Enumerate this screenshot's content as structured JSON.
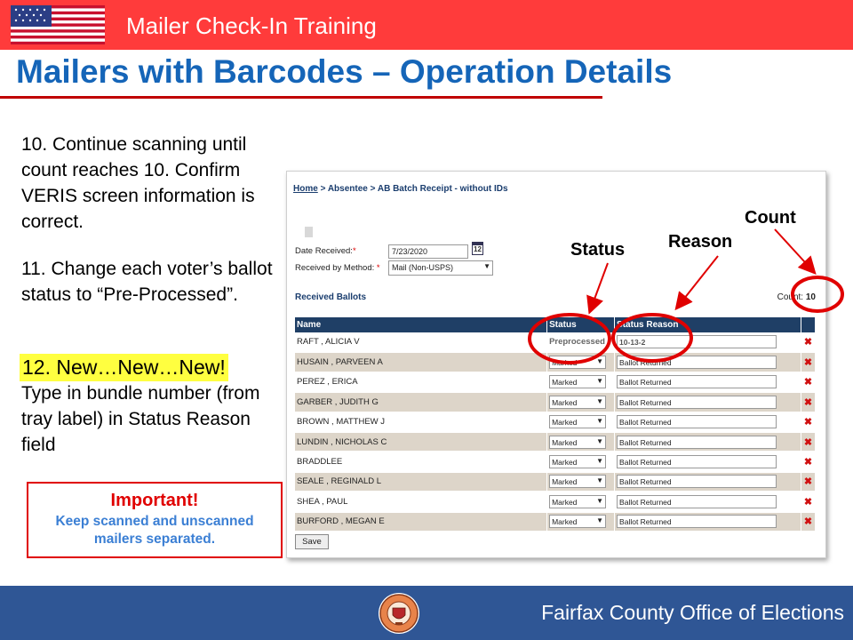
{
  "header": {
    "title": "Mailer Check-In Training",
    "main_title": "Mailers with Barcodes – Operation Details"
  },
  "steps": {
    "step10": "10.  Continue scanning until count reaches 10. Confirm VERIS screen information is correct.",
    "step11": "11.  Change each voter’s ballot status to “Pre-Processed”.",
    "step12_head": "12.  New…New…New!",
    "step12": "Type in bundle number (from tray label) in Status Reason field"
  },
  "important": {
    "title": "Important!",
    "body": "Keep scanned and unscanned mailers separated."
  },
  "screen": {
    "breadcrumb_home": "Home",
    "breadcrumb_rest": " > Absentee > AB Batch Receipt - without IDs",
    "date_label": "Date Received:",
    "date_value": "7/23/2020",
    "calendar_icon_text": "12",
    "method_label": "Received by Method:",
    "method_value": "Mail (Non-USPS)",
    "required_mark": "*",
    "received_ballots": "Received Ballots",
    "count_label": "Count:",
    "count_value": "10",
    "columns": [
      "Name",
      "Status",
      "Status Reason"
    ],
    "rows": [
      {
        "name": "RAFT , ALICIA V",
        "status": "Preprocessed",
        "reason": "10-13-2"
      },
      {
        "name": "HUSAIN , PARVEEN A",
        "status": "Marked",
        "reason": "Ballot Returned"
      },
      {
        "name": "PEREZ , ERICA",
        "status": "Marked",
        "reason": "Ballot Returned"
      },
      {
        "name": "GARBER , JUDITH G",
        "status": "Marked",
        "reason": "Ballot Returned"
      },
      {
        "name": "BROWN , MATTHEW J",
        "status": "Marked",
        "reason": "Ballot Returned"
      },
      {
        "name": "LUNDIN , NICHOLAS C",
        "status": "Marked",
        "reason": "Ballot Returned"
      },
      {
        "name": "BRADDLEE",
        "status": "Marked",
        "reason": "Ballot Returned"
      },
      {
        "name": "SEALE , REGINALD L",
        "status": "Marked",
        "reason": "Ballot Returned"
      },
      {
        "name": "SHEA , PAUL",
        "status": "Marked",
        "reason": "Ballot Returned"
      },
      {
        "name": "BURFORD , MEGAN E",
        "status": "Marked",
        "reason": "Ballot Returned"
      }
    ],
    "save_label": "Save",
    "delete_glyph": "✖"
  },
  "annotations": {
    "count": "Count",
    "status": "Status",
    "reason": "Reason",
    "color": "#e00000"
  },
  "footer": {
    "org": "Fairfax County Office of Elections"
  },
  "icons": {
    "flag": "us-flag-icon",
    "seal": "county-seal-icon",
    "calendar": "calendar-icon",
    "delete": "delete-x-icon"
  },
  "colors": {
    "top_bar": "#ff3b3b",
    "title": "#1565b8",
    "footer": "#2f5695",
    "table_header": "#1f3f66",
    "highlight": "#ffff40"
  }
}
